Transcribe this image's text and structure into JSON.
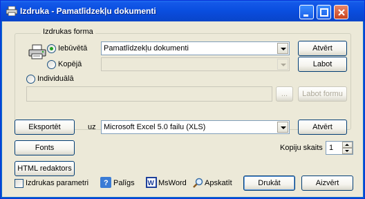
{
  "window": {
    "title": "Izdruka - Pamatlīdzekļu dokumenti"
  },
  "print_form": {
    "legend": "Izdrukas forma",
    "radio_builtin": "Iebūvētā",
    "radio_shared": "Kopējā",
    "radio_individual": "Individuālā",
    "builtin_value": "Pamatlīdzekļu dokumenti",
    "shared_value": "",
    "individual_path": "",
    "selected": "Iebūvētā",
    "open_builtin": "Atvērt",
    "edit_shared": "Labot",
    "browse": "...",
    "edit_form": "Labot formu"
  },
  "export": {
    "button": "Eksportēt",
    "to_label": "uz",
    "format": "Microsoft Excel 5.0 failu (XLS)",
    "open": "Atvērt"
  },
  "fonts": {
    "button": "Fonts"
  },
  "copies": {
    "label": "Kopiju skaits",
    "value": "1"
  },
  "html_editor": {
    "button": "HTML redaktors"
  },
  "bottom": {
    "print_params": "Izdrukas parametri",
    "help": "Palīgs",
    "msword": "MsWord",
    "preview": "Apskatīt",
    "print": "Drukāt",
    "close": "Aizvērt"
  }
}
